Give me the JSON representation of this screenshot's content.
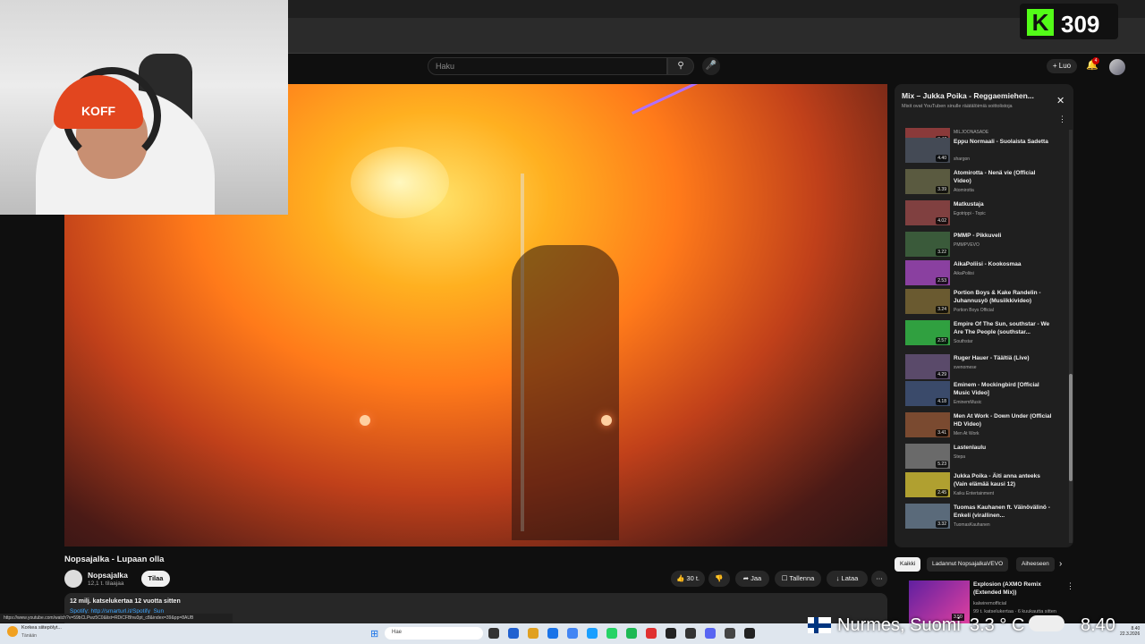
{
  "search": {
    "placeholder": "Haku"
  },
  "header": {
    "create_label": "Luo",
    "notifications_count": "4"
  },
  "kick": {
    "logo": "K",
    "viewer_count": "309"
  },
  "webcam": {
    "cap_text": "KOFF"
  },
  "video": {
    "title": "Nopsajalka - Lupaan olla",
    "channel": "Nopsajalka",
    "subscribers": "12,1 t. tilaajaa",
    "subscribe_label": "Tilaa",
    "likes": "30 t.",
    "share_label": "Jaa",
    "save_label": "Tallenna",
    "download_label": "Lataa",
    "desc_stats": "12 milj. katselukertaa  12 vuotta sitten",
    "desc_link": "Spotify: http://smarturl.it/Spotify_Sun"
  },
  "statusbar": {
    "url": "https://www.youtube.com/watch?v=59bCLPwz5C0&list=RDiCFBhw3pt_c8&index=39&pp=8AUB"
  },
  "playlist": {
    "title": "Mix – Jukka Poika - Reggaemiehen...",
    "subtitle": "Mixit ovat YouTuben sinulle räätälöimiä soittolistoja",
    "items": [
      {
        "title": "Mansikat",
        "channel": "MILJOONASADE",
        "duration": "3.47"
      },
      {
        "title": "Eppu Normaali - Suolaista Sadetta",
        "channel": "shargon",
        "duration": "4.40"
      },
      {
        "title": "Atomirotta - Nenä vie (Official Video)",
        "channel": "Atomirotta",
        "duration": "3.39"
      },
      {
        "title": "Matkustaja",
        "channel": "Egotrippi - Topic",
        "duration": "4.02"
      },
      {
        "title": "PMMP - Pikkuveli",
        "channel": "PMMPVEVO",
        "duration": "3.22"
      },
      {
        "title": "AikaPoliisi - Kookosmaa",
        "channel": "AikaPoliisi",
        "duration": "2.53"
      },
      {
        "title": "Portion Boys & Kake Randelin - Juhannusyö (Musiikkivideo)",
        "channel": "Portion Boys Official",
        "duration": "3.24"
      },
      {
        "title": "Empire Of The Sun, southstar - We Are The People (southstar...",
        "channel": "Southstar",
        "duration": "2.57"
      },
      {
        "title": "Ruger Hauer - Täältiä (Live)",
        "channel": "svenomese",
        "duration": "4.29"
      },
      {
        "title": "Eminem - Mockingbird [Official Music Video]",
        "channel": "EminemMusic",
        "duration": "4.18"
      },
      {
        "title": "Men At Work - Down Under (Official HD Video)",
        "channel": "Men At Work",
        "duration": "3.41"
      },
      {
        "title": "Lastenlaulu",
        "channel": "Stepa",
        "duration": "5.23"
      },
      {
        "title": "Jukka Poika - Äiti anna anteeks (Vain elämää kausi 12)",
        "channel": "Kaiku Entertainment",
        "duration": "2.45"
      },
      {
        "title": "Tuomas Kauhanen ft. Väinövälinö - Enkeli (virallinen...",
        "channel": "TuomasKauhanen",
        "duration": "3.32"
      }
    ]
  },
  "chips": [
    "Kaikki",
    "Ladannut NopsajalkaVEVO",
    "Aiheeseen"
  ],
  "recommendation": {
    "title": "Explosion (AXMO Remix (Extended Mix))",
    "channel": "kalwiremofficial",
    "stats": "99 t. katselukertaa · 6 kuukautta sitten",
    "duration": "3.50"
  },
  "taskbar": {
    "weather_title": "Korkea siitepölyt...",
    "weather_sub": "Tänään",
    "search": "Hae",
    "clock_time": "8.40",
    "clock_date": "22.3.2026"
  },
  "overlay": {
    "location": "Nurmes, Suomi",
    "temperature": "3.3 ° C",
    "time": "8.40"
  },
  "colors": {
    "accent": "#3ea6ff",
    "kick_green": "#53fc18",
    "subscribe_bg": "#f1f1f1"
  }
}
